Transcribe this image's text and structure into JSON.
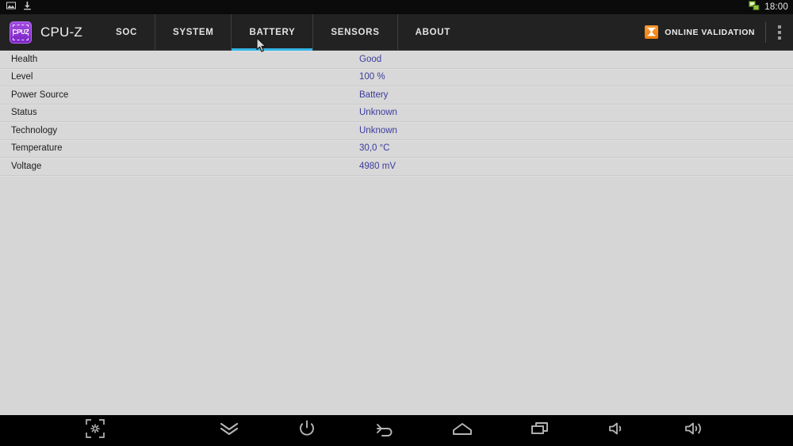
{
  "status_bar": {
    "icons": [
      "image-icon",
      "download-icon",
      "ethernet-icon"
    ],
    "clock": "18:00"
  },
  "toolbar": {
    "logo_text": "CPUZ",
    "app_title": "CPU-Z",
    "tabs": [
      {
        "label": "SOC",
        "active": false
      },
      {
        "label": "SYSTEM",
        "active": false
      },
      {
        "label": "BATTERY",
        "active": true
      },
      {
        "label": "SENSORS",
        "active": false
      },
      {
        "label": "ABOUT",
        "active": false
      }
    ],
    "online_validation_label": "ONLINE VALIDATION",
    "overflow_label": "More options",
    "accent_color": "#33b5e5",
    "validation_icon_color": "#ef7d0c",
    "logo_color": "#7a22c4"
  },
  "battery": {
    "rows": [
      {
        "label": "Health",
        "value": "Good"
      },
      {
        "label": "Level",
        "value": "100 %"
      },
      {
        "label": "Power Source",
        "value": "Battery"
      },
      {
        "label": "Status",
        "value": "Unknown"
      },
      {
        "label": "Technology",
        "value": "Unknown"
      },
      {
        "label": "Temperature",
        "value": "30,0 °C"
      },
      {
        "label": "Voltage",
        "value": "4980 mV"
      }
    ],
    "value_color": "#3b3b9e",
    "label_color": "#1c1c1c"
  },
  "navigation_bar": {
    "buttons": [
      {
        "name": "screenshot-icon",
        "label": "Screenshot"
      },
      {
        "name": "collapse-icon",
        "label": "Collapse"
      },
      {
        "name": "power-icon",
        "label": "Power"
      },
      {
        "name": "back-icon",
        "label": "Back"
      },
      {
        "name": "home-icon",
        "label": "Home"
      },
      {
        "name": "recents-icon",
        "label": "Recent apps"
      },
      {
        "name": "volume-down-icon",
        "label": "Volume down"
      },
      {
        "name": "volume-up-icon",
        "label": "Volume up"
      }
    ]
  }
}
